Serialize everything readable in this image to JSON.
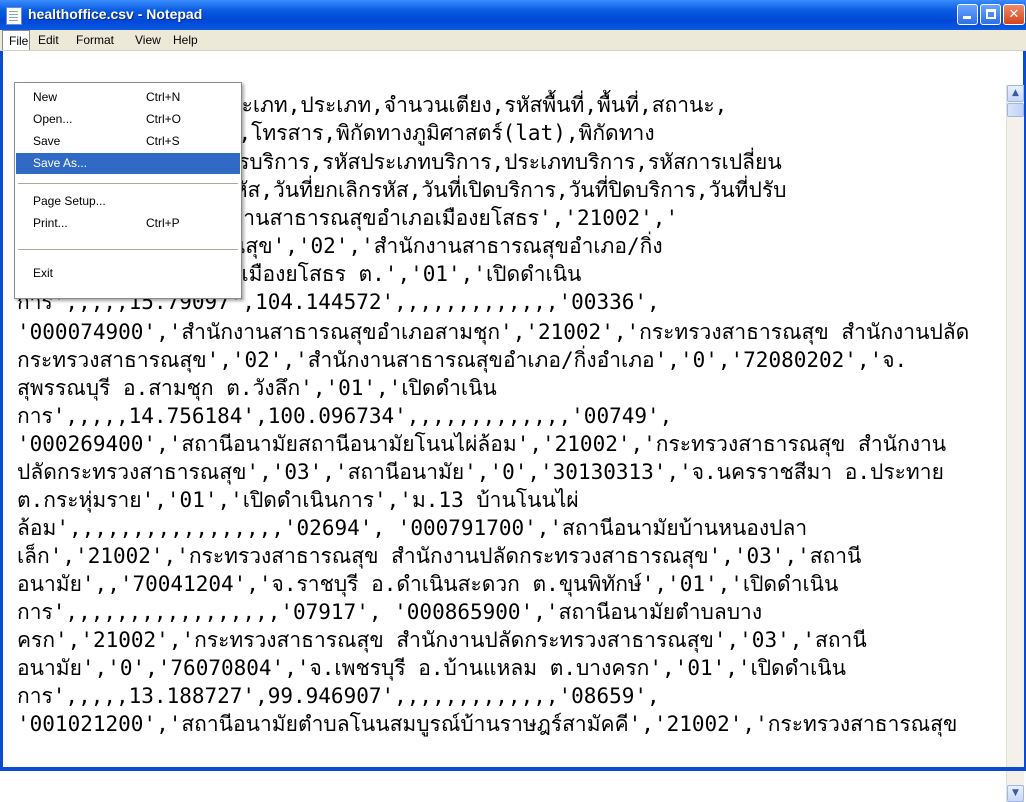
{
  "window": {
    "title": "healthoffice.csv - Notepad",
    "icon": "notepad-icon"
  },
  "menubar": {
    "items": [
      "File",
      "Edit",
      "Format",
      "View",
      "Help"
    ],
    "active": "File"
  },
  "file_menu": {
    "items": [
      {
        "label": "New",
        "shortcut": "Ctrl+N"
      },
      {
        "label": "Open...",
        "shortcut": "Ctrl+O"
      },
      {
        "label": "Save",
        "shortcut": "Ctrl+S"
      },
      {
        "label": "Save As...",
        "shortcut": "",
        "highlighted": true
      },
      {
        "label": "Page Setup...",
        "shortcut": ""
      },
      {
        "label": "Print...",
        "shortcut": "Ctrl+P"
      },
      {
        "label": "Exit",
        "shortcut": ""
      }
    ]
  },
  "editor": {
    "lines": [
      "รหัสสังกัด,สังกัด,รหัสประเภท,ประเภท,จำนวนเตียง,รหัสพื้นที่,พื้นที่,สถานะ,",
      ",รหัสไปรษณีย์,โทรศัพท์,โทรสาร,พิกัดทางภูมิศาสตร์(lat),พิกัดทาง",
      "ะดับการบริการ,ระดับการบริการ,รหัสประเภทบริการ,ประเภทบริการ,รหัสการเปลี่ยน",
      "หมายเหตุ,วันที่กำหนดรหัส,วันที่ยกเลิกรหัส,วันที่เปิดบริการ,วันที่ปิดบริการ,วันที่ปรับ",
      "'000033600','สำนักงานสาธารณสุขอำเภอเมืองยโสธร','21002','",
      "านปลัดกระทรวงสาธารณสุข','02','สำนักงานสาธารณสุขอำเภอ/กิ่ง",
      "10000','จ.ยโสธร อ.เมืองยโสธร ต.','01','เปิดดำเนิน",
      "การ',,,,,15.79097',104.144572',,,,,,,,,,,,,'00336',",
      "'000074900','สำนักงานสาธารณสุขอำเภอสามชุก','21002','กระทรวงสาธารณสุข สำนักงานปลัด",
      "กระทรวงสาธารณสุข','02','สำนักงานสาธารณสุขอำเภอ/กิ่งอำเภอ','0','72080202','จ.",
      "สุพรรณบุรี อ.สามชุก ต.วังลึก','01','เปิดดำเนิน",
      "การ',,,,,14.756184',100.096734',,,,,,,,,,,,,'00749',",
      "'000269400','สถานีอนามัยสถานีอนามัยโนนไผ่ล้อม','21002','กระทรวงสาธารณสุข สำนักงาน",
      "ปลัดกระทรวงสาธารณสุข','03','สถานีอนามัย','0','30130313','จ.นครราชสีมา อ.ประทาย",
      "ต.กระหุ่มราย','01','เปิดดำเนินการ','ม.13 บ้านโนนไผ่",
      "ล้อม',,,,,,,,,,,,,,,,,'02694', '000791700','สถานีอนามัยบ้านหนองปลา",
      "เล็ก','21002','กระทรวงสาธารณสุข สำนักงานปลัดกระทรวงสาธารณสุข','03','สถานี",
      "อนามัย',,'70041204','จ.ราชบุรี อ.ดำเนินสะดวก ต.ขุนพิทักษ์','01','เปิดดำเนิน",
      "การ',,,,,,,,,,,,,,,,,'07917', '000865900','สถานีอนามัยตำบลบาง",
      "ครก','21002','กระทรวงสาธารณสุข สำนักงานปลัดกระทรวงสาธารณสุข','03','สถานี",
      "อนามัย','0','76070804','จ.เพชรบุรี อ.บ้านแหลม ต.บางครก','01','เปิดดำเนิน",
      "การ',,,,,13.188727',99.946907',,,,,,,,,,,,,'08659',",
      "'001021200','สถานีอนามัยตำบลโนนสมบูรณ์บ้านราษฎร์สามัคคี','21002','กระทรวงสาธารณสุข"
    ]
  },
  "colors": {
    "title_bar": "#0a5ce0",
    "menu_highlight": "#316ac5",
    "close_button": "#d5431a"
  }
}
